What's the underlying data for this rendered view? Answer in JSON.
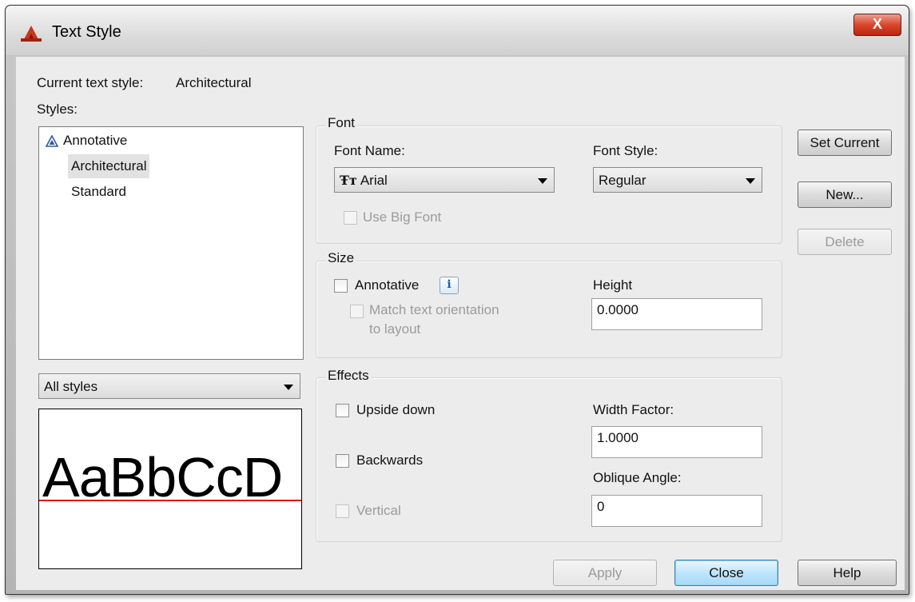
{
  "window": {
    "title": "Text Style",
    "close_label": "X",
    "accent_color": "#c8371d"
  },
  "current_style": {
    "label": "Current text style:",
    "value": "Architectural"
  },
  "styles": {
    "label": "Styles:",
    "items": [
      {
        "label": "Annotative",
        "icon": "annotative-icon",
        "selected": false
      },
      {
        "label": "Architectural",
        "icon": "",
        "selected": true
      },
      {
        "label": "Standard",
        "icon": "",
        "selected": false
      }
    ],
    "filter_value": "All styles"
  },
  "preview": {
    "text": "AaBbCcD",
    "baseline_color": "#e01010"
  },
  "font": {
    "group_label": "Font",
    "name_label": "Font Name:",
    "name_value": "Arial",
    "name_icon": "truetype-icon",
    "style_label": "Font Style:",
    "style_value": "Regular",
    "big_font_label": "Use Big Font"
  },
  "size": {
    "group_label": "Size",
    "annotative_label": "Annotative",
    "info_glyph": "i",
    "match_label_line1": "Match text orientation",
    "match_label_line2": "to layout",
    "height_label": "Height",
    "height_value": "0.0000"
  },
  "effects": {
    "group_label": "Effects",
    "upside_down_label": "Upside down",
    "backwards_label": "Backwards",
    "vertical_label": "Vertical",
    "width_factor_label": "Width Factor:",
    "width_factor_value": "1.0000",
    "oblique_label": "Oblique Angle:",
    "oblique_value": "0"
  },
  "buttons": {
    "set_current": "Set Current",
    "new": "New...",
    "delete": "Delete",
    "apply": "Apply",
    "close": "Close",
    "help": "Help"
  }
}
